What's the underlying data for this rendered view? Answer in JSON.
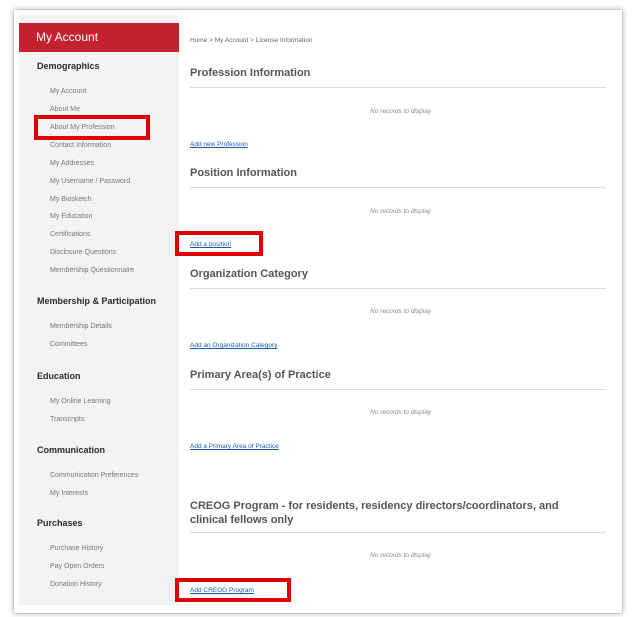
{
  "sidebar": {
    "header": "My Account",
    "sections": [
      {
        "title": "Demographics",
        "items": [
          "My Account",
          "About Me",
          "About My Profession",
          "Contact Information",
          "My Addresses",
          "My Username / Password",
          "My Biosketch",
          "My Education",
          "Certifications",
          "Disclosure Questions",
          "Membership Questionnaire"
        ]
      },
      {
        "title": "Membership & Participation",
        "items": [
          "Membership Details",
          "Committees"
        ]
      },
      {
        "title": "Education",
        "items": [
          "My Online Learning",
          "Transcripts"
        ]
      },
      {
        "title": "Communication",
        "items": [
          "Communication Preferences",
          "My Interests"
        ]
      },
      {
        "title": "Purchases",
        "items": [
          "Purchase History",
          "Pay Open Orders",
          "Donation History"
        ]
      }
    ]
  },
  "breadcrumb": "Home > My Account > License Information",
  "blocks": [
    {
      "title": "Profession Information",
      "empty": "No records to display",
      "link": "Add new Profession"
    },
    {
      "title": "Position Information",
      "empty": "No records to display",
      "link": "Add a position"
    },
    {
      "title": "Organization Category",
      "empty": "No records to display",
      "link": "Add an Organization Category"
    },
    {
      "title": "Primary Area(s) of Practice",
      "empty": "No records to display",
      "link": "Add a Primary Area of Practice"
    },
    {
      "title": "CREOG Program - for residents, residency directors/coordinators, and clinical fellows only",
      "empty": "No records to display",
      "link": "Add CREOG Program"
    }
  ],
  "colors": {
    "accent": "#c4222f",
    "highlight": "#e00000",
    "link": "#1a5aa6"
  }
}
